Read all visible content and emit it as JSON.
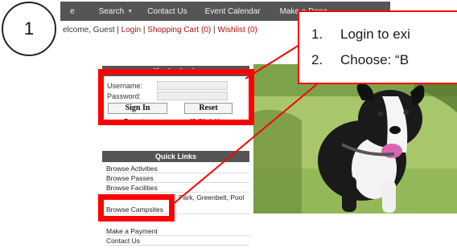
{
  "step_number": "1",
  "nav": {
    "items": [
      "e",
      "Search",
      "Contact Us",
      "Event Calendar",
      "Make a Dona"
    ]
  },
  "welcome": {
    "prefix": "elcome, Guest |",
    "login": "Login",
    "sep1": "|",
    "cart": "Shopping Cart (0)",
    "sep2": "|",
    "wishlist": "Wishlist (0)"
  },
  "login_panel": {
    "title": "Member Login",
    "username_label": "Username:",
    "password_label": "Password:",
    "sign_in": "Sign In",
    "reset": "Reset",
    "forgot_text": "Forgot your password?",
    "forgot_link": "Click Here"
  },
  "quick_links": {
    "title": "Quick Links",
    "items": [
      "Browse Activities",
      "Browse Passes",
      "Browse Facilities",
      "Park, Greenbelt, Pool",
      "Browse Campsites",
      "Make a Payment",
      "Contact Us"
    ]
  },
  "callout": {
    "lines": [
      {
        "num": "1.",
        "text": "Login to exi"
      },
      {
        "num": "2.",
        "text": "Choose: “B"
      }
    ]
  },
  "colors": {
    "highlight": "#ff0000",
    "nav_bg": "#555555",
    "link_red": "#b01010"
  }
}
